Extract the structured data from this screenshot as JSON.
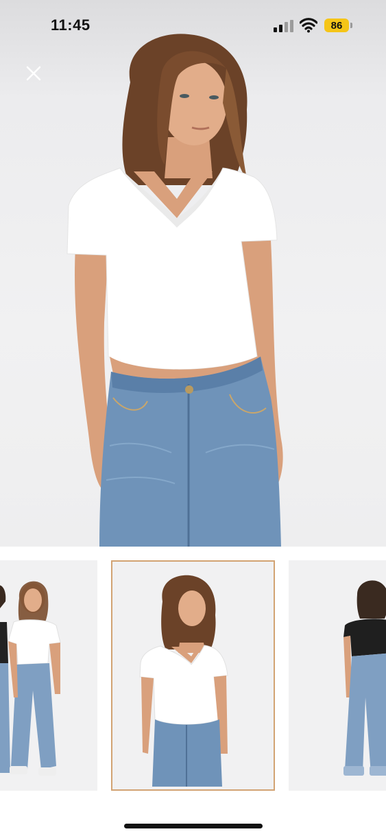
{
  "status_bar": {
    "time": "11:45",
    "battery_level": "86",
    "battery_color": "#f5c518"
  },
  "toolbar": {
    "close_icon": "close-icon"
  },
  "gallery": {
    "main_image": "model-white-vneck-tee-blue-jeans-front",
    "thumbnails": [
      {
        "image": "two-models-white-and-black-tees",
        "selected": false
      },
      {
        "image": "model-white-vneck-tee-front",
        "selected": true
      },
      {
        "image": "model-black-tee-back",
        "selected": false
      }
    ],
    "selected_outline_color": "#d2a373"
  }
}
